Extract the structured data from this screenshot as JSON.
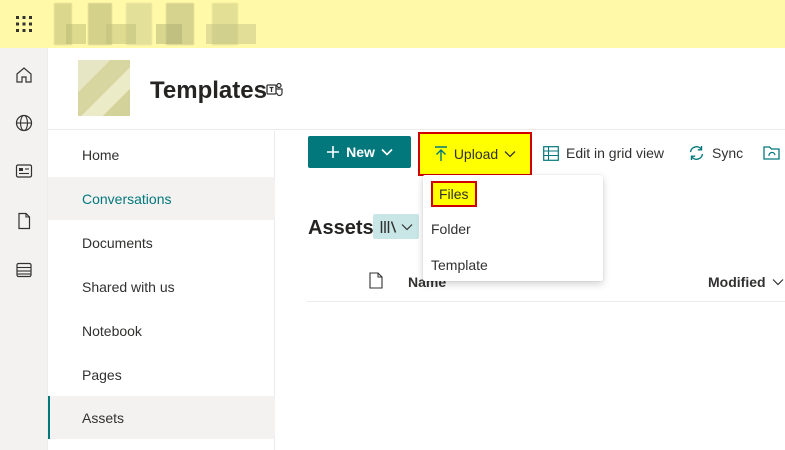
{
  "topbar": {
    "app_launcher": "waffle-icon"
  },
  "rail": {
    "items": [
      "home-icon",
      "globe-icon",
      "news-icon",
      "document-icon",
      "list-icon"
    ]
  },
  "site": {
    "title": "Templates"
  },
  "nav": {
    "items": [
      {
        "label": "Home"
      },
      {
        "label": "Conversations"
      },
      {
        "label": "Documents"
      },
      {
        "label": "Shared with us"
      },
      {
        "label": "Notebook"
      },
      {
        "label": "Pages"
      },
      {
        "label": "Assets"
      }
    ],
    "hovered": "Conversations",
    "selected": "Assets"
  },
  "commandbar": {
    "new_label": "New",
    "upload_label": "Upload",
    "grid_label": "Edit in grid view",
    "sync_label": "Sync"
  },
  "upload_menu": {
    "items": [
      {
        "label": "Files"
      },
      {
        "label": "Folder"
      },
      {
        "label": "Template"
      }
    ],
    "highlighted": "Files"
  },
  "library": {
    "title": "Assets",
    "columns": {
      "name": "Name",
      "modified": "Modified"
    }
  },
  "colors": {
    "accent": "#03787c",
    "highlight": "#ffff00",
    "outline": "#d00000",
    "topbar": "#fff9a8"
  }
}
